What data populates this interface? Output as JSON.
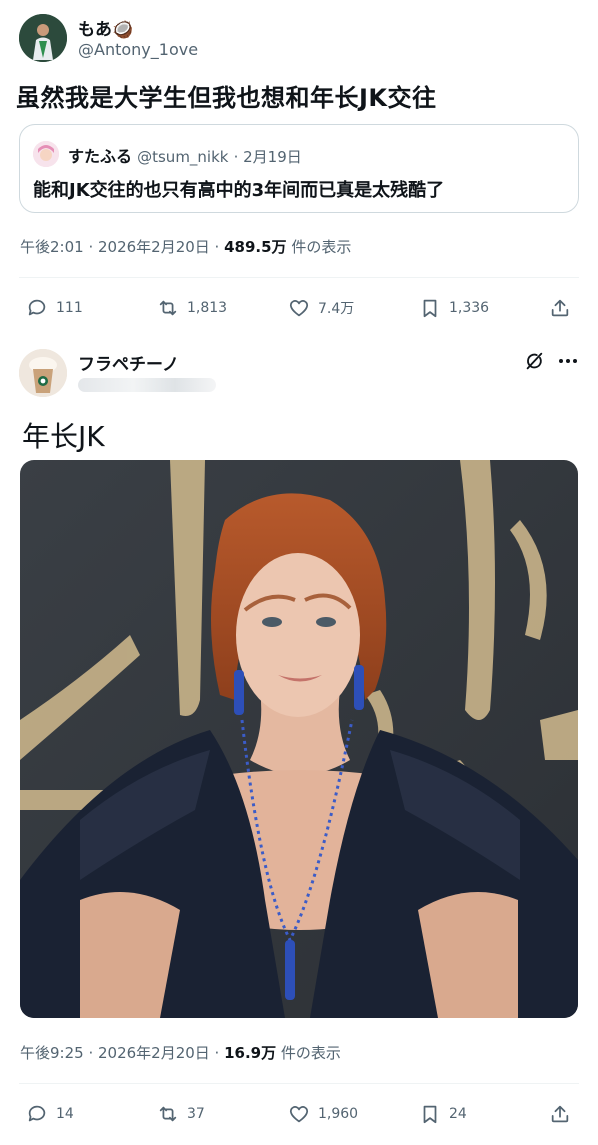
{
  "tweet1": {
    "display_name": "もあ🥥",
    "handle": "@Antony_1ove",
    "text": "虽然我是大学生但我也想和年长JK交往",
    "quote": {
      "display_name": "すたふる",
      "handle": "@tsum_nikk",
      "date": "· 2月19日",
      "text": "能和JK交往的也只有高中的3年间而已真是太残酷了"
    },
    "meta": {
      "time": "午後2:01 · 2026年2月20日 · ",
      "views": "489.5万",
      "views_label": " 件の表示"
    },
    "actions": {
      "replies": "111",
      "reposts": "1,813",
      "likes": "7.4万",
      "bookmarks": "1,336"
    }
  },
  "tweet2": {
    "display_name": "フラペチーノ",
    "text": "年长JK",
    "meta": {
      "time": "午後9:25 · 2026年2月20日 · ",
      "views": "16.9万",
      "views_label": " 件の表示"
    },
    "actions": {
      "replies": "14",
      "reposts": "37",
      "likes": "1,960",
      "bookmarks": "24"
    }
  },
  "icons": [
    "reply-icon",
    "repost-icon",
    "like-icon",
    "bookmark-icon",
    "share-icon",
    "grok-icon",
    "more-icon"
  ],
  "colors": {
    "text": "#0f1419",
    "secondary": "#536471",
    "divider": "#eff3f4",
    "border": "#cfd9de"
  }
}
